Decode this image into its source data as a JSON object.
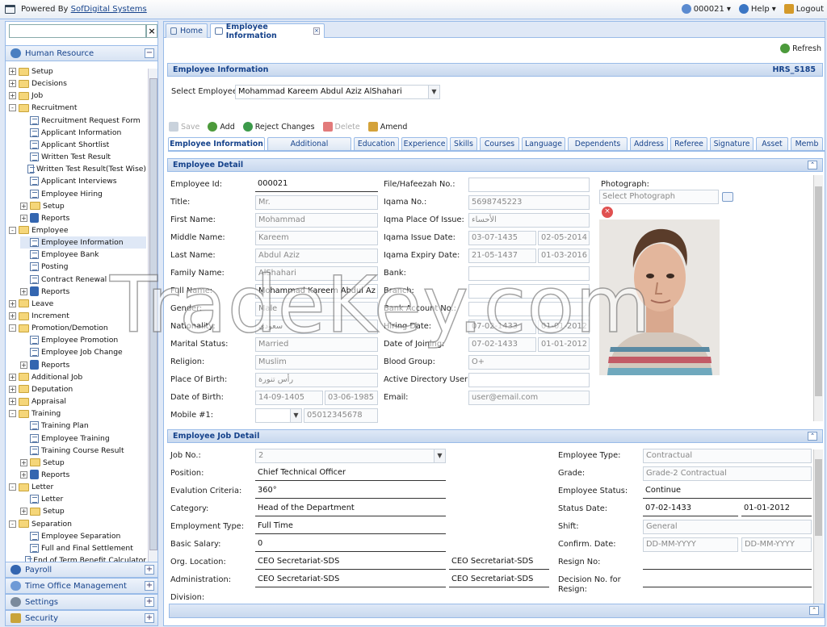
{
  "topbar": {
    "powered_by": "Powered By ",
    "company": "SofDigital Systems",
    "user": "000021",
    "help": "Help",
    "logout": "Logout"
  },
  "left": {
    "search_placeholder": "",
    "accordion": {
      "human_resource": "Human Resource",
      "payroll": "Payroll",
      "time_office": "Time Office Management",
      "settings": "Settings",
      "security": "Security"
    },
    "tree": [
      {
        "label": "Setup",
        "type": "folder",
        "level": 0,
        "exp": "+"
      },
      {
        "label": "Decisions",
        "type": "folder",
        "level": 0,
        "exp": "+"
      },
      {
        "label": "Job",
        "type": "folder",
        "level": 0,
        "exp": "+"
      },
      {
        "label": "Recruitment",
        "type": "folder",
        "level": 0,
        "exp": "-"
      },
      {
        "label": "Recruitment Request Form",
        "type": "doc",
        "level": 1
      },
      {
        "label": "Applicant Information",
        "type": "doc",
        "level": 1
      },
      {
        "label": "Applicant Shortlist",
        "type": "doc",
        "level": 1
      },
      {
        "label": "Written Test Result",
        "type": "doc",
        "level": 1
      },
      {
        "label": "Written Test Result(Test Wise)",
        "type": "doc",
        "level": 1
      },
      {
        "label": "Applicant Interviews",
        "type": "doc",
        "level": 1
      },
      {
        "label": "Employee Hiring",
        "type": "doc",
        "level": 1
      },
      {
        "label": "Setup",
        "type": "folder",
        "level": 1,
        "exp": "+"
      },
      {
        "label": "Reports",
        "type": "rep",
        "level": 1,
        "exp": "+"
      },
      {
        "label": "Employee",
        "type": "folder",
        "level": 0,
        "exp": "-"
      },
      {
        "label": "Employee Information",
        "type": "doc",
        "level": 1,
        "sel": true
      },
      {
        "label": "Employee Bank",
        "type": "doc",
        "level": 1
      },
      {
        "label": "Posting",
        "type": "doc",
        "level": 1
      },
      {
        "label": "Contract Renewal",
        "type": "doc",
        "level": 1
      },
      {
        "label": "Reports",
        "type": "rep",
        "level": 1,
        "exp": "+"
      },
      {
        "label": "Leave",
        "type": "folder",
        "level": 0,
        "exp": "+"
      },
      {
        "label": "Increment",
        "type": "folder",
        "level": 0,
        "exp": "+"
      },
      {
        "label": "Promotion/Demotion",
        "type": "folder",
        "level": 0,
        "exp": "-"
      },
      {
        "label": "Employee Promotion",
        "type": "doc",
        "level": 1
      },
      {
        "label": "Employee Job Change",
        "type": "doc",
        "level": 1
      },
      {
        "label": "Reports",
        "type": "rep",
        "level": 1,
        "exp": "+"
      },
      {
        "label": "Additional Job",
        "type": "folder",
        "level": 0,
        "exp": "+"
      },
      {
        "label": "Deputation",
        "type": "folder",
        "level": 0,
        "exp": "+"
      },
      {
        "label": "Appraisal",
        "type": "folder",
        "level": 0,
        "exp": "+"
      },
      {
        "label": "Training",
        "type": "folder",
        "level": 0,
        "exp": "-"
      },
      {
        "label": "Training Plan",
        "type": "doc",
        "level": 1
      },
      {
        "label": "Employee Training",
        "type": "doc",
        "level": 1
      },
      {
        "label": "Training Course Result",
        "type": "doc",
        "level": 1
      },
      {
        "label": "Setup",
        "type": "folder",
        "level": 1,
        "exp": "+"
      },
      {
        "label": "Reports",
        "type": "rep",
        "level": 1,
        "exp": "+"
      },
      {
        "label": "Letter",
        "type": "folder",
        "level": 0,
        "exp": "-"
      },
      {
        "label": "Letter",
        "type": "doc",
        "level": 1
      },
      {
        "label": "Setup",
        "type": "folder",
        "level": 1,
        "exp": "+"
      },
      {
        "label": "Separation",
        "type": "folder",
        "level": 0,
        "exp": "-"
      },
      {
        "label": "Employee Separation",
        "type": "doc",
        "level": 1
      },
      {
        "label": "Full and Final Settlement",
        "type": "doc",
        "level": 1
      },
      {
        "label": "End of Term Benefit Calculator",
        "type": "doc",
        "level": 1
      }
    ]
  },
  "tabs": {
    "home": "Home",
    "employee_info": "Employee Information"
  },
  "refresh": "Refresh",
  "header": {
    "title": "Employee Information",
    "code": "HRS_S185",
    "select_label": "Select Employee:",
    "selected_employee": "Mohammad Kareem Abdul Aziz AlShahari"
  },
  "toolbar": {
    "save": "Save",
    "add": "Add",
    "reject": "Reject Changes",
    "delete": "Delete",
    "amend": "Amend"
  },
  "subtabs": [
    "Employee Information",
    "Additional Information",
    "Education",
    "Experience",
    "Skills",
    "Courses",
    "Language",
    "Dependents",
    "Address",
    "Referee",
    "Signature",
    "Asset",
    "Memb"
  ],
  "detail": {
    "title": "Employee Detail",
    "employee_id_label": "Employee Id:",
    "employee_id": "000021",
    "title_label": "Title:",
    "title_val": "Mr.",
    "first_name_label": "First Name:",
    "first_name": "Mohammad",
    "middle_name_label": "Middle Name:",
    "middle_name": "Kareem",
    "last_name_label": "Last Name:",
    "last_name": "Abdul Aziz",
    "family_name_label": "Family Name:",
    "family_name": "AlShahari",
    "full_name_label": "Full Name:",
    "full_name": "Mohammad Kareem Abdul Az",
    "gender_label": "Gender:",
    "gender": "Male",
    "nationality_label": "Nationality:",
    "nationality": "سعودي",
    "marital_label": "Marital Status:",
    "marital": "Married",
    "religion_label": "Religion:",
    "religion": "Muslim",
    "pob_label": "Place Of Birth:",
    "pob": "رأس تنورة",
    "dob_label": "Date of Birth:",
    "dob_h": "14-09-1405",
    "dob_g": "03-06-1985",
    "mobile_label": "Mobile #1:",
    "mobile": "05012345678",
    "file_label": "File/Hafeezah No.:",
    "file": "",
    "iqama_label": "Iqama No.:",
    "iqama": "5698745223",
    "iqama_place_label": "Iqma Place Of Issue:",
    "iqama_place": "الأحساء",
    "iqama_issue_label": "Iqama Issue Date:",
    "iqama_issue_h": "03-07-1435",
    "iqama_issue_g": "02-05-2014",
    "iqama_expiry_label": "Iqama Expiry Date:",
    "iqama_expiry_h": "21-05-1437",
    "iqama_expiry_g": "01-03-2016",
    "bank_label": "Bank:",
    "bank": "",
    "branch_label": "Branch:",
    "branch": "",
    "bank_acc_label": "Bank Account No.:",
    "bank_acc": "",
    "hiring_label": "Hiring Date:",
    "hiring_h": "07-02-1433",
    "hiring_g": "01-01-2012",
    "joining_label": "Date of Joining:",
    "joining_h": "07-02-1433",
    "joining_g": "01-01-2012",
    "blood_label": "Blood Group:",
    "blood": "O+",
    "ad_user_label": "Active Directory User:",
    "ad_user": "",
    "email_label": "Email:",
    "email": "user@email.com",
    "photo_label": "Photograph:",
    "photo_placeholder": "Select Photograph"
  },
  "job": {
    "title": "Employee Job Detail",
    "jobno_label": "Job No.:",
    "jobno": "2",
    "position_label": "Position:",
    "position": "Chief Technical Officer",
    "eval_label": "Evalution Criteria:",
    "eval": "360°",
    "category_label": "Category:",
    "category": "Head of the Department",
    "emptype_label": "Employment Type:",
    "emptype": "Full Time",
    "salary_label": "Basic Salary:",
    "salary": "0",
    "org_label": "Org. Location:",
    "org": "CEO Secretariat-SDS",
    "org2": "CEO Secretariat-SDS",
    "admin_label": "Administration:",
    "admin": "CEO Secretariat-SDS",
    "admin2": "CEO Secretariat-SDS",
    "division_label": "Division:",
    "etype_label": "Employee Type:",
    "etype": "Contractual",
    "grade_label": "Grade:",
    "grade": "Grade-2 Contractual",
    "status_label": "Employee Status:",
    "status": "Continue",
    "status_date_label": "Status Date:",
    "status_h": "07-02-1433",
    "status_g": "01-01-2012",
    "shift_label": "Shift:",
    "shift": "General",
    "confirm_label": "Confirm. Date:",
    "confirm_ph": "DD-MM-YYYY",
    "confirm_ph2": "DD-MM-YYYY",
    "resign_label": "Resign No:",
    "decision_label": "Decision No. for",
    "decision_label2": "Resign:"
  },
  "watermark": "TradeKey.com"
}
